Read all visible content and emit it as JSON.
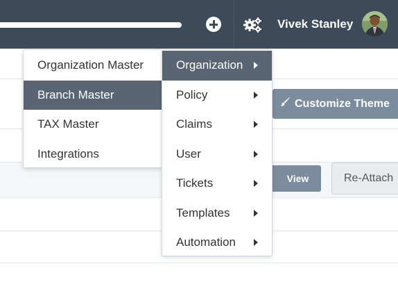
{
  "header": {
    "user_name": "Vivek Stanley",
    "icons": {
      "add": "plus-circle-icon",
      "settings": "gears-icon",
      "avatar": "user-avatar"
    }
  },
  "buttons": {
    "customize_theme": "Customize Theme",
    "view": "View",
    "re_attach": "Re-Attach"
  },
  "main_menu": {
    "items": [
      {
        "label": "Organization",
        "active": true
      },
      {
        "label": "Policy"
      },
      {
        "label": "Claims"
      },
      {
        "label": "User"
      },
      {
        "label": "Tickets"
      },
      {
        "label": "Templates"
      },
      {
        "label": "Automation"
      }
    ]
  },
  "organization_submenu": {
    "items": [
      {
        "label": "Organization Master"
      },
      {
        "label": "Branch Master",
        "active": true
      },
      {
        "label": "TAX Master"
      },
      {
        "label": "Integrations"
      }
    ]
  },
  "colors": {
    "topbar": "#3d4a59",
    "active_menu": "#5a6573",
    "button": "#7b8c9e"
  }
}
